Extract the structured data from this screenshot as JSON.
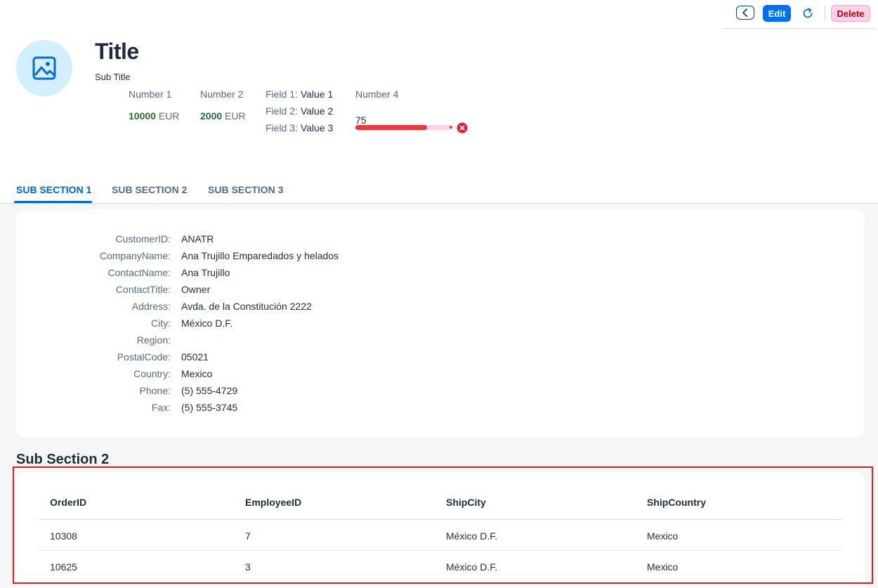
{
  "toolbar": {
    "edit_label": "Edit",
    "delete_label": "Delete"
  },
  "header": {
    "title": "Title",
    "subtitle": "Sub Title",
    "kpis": [
      {
        "label": "Number 1",
        "value": "10000",
        "unit": "EUR"
      },
      {
        "label": "Number 2",
        "value": "2000",
        "unit": "EUR"
      }
    ],
    "fields": [
      {
        "label": "Field 1:",
        "value": "Value 1"
      },
      {
        "label": "Field 2:",
        "value": "Value 2"
      },
      {
        "label": "Field 3:",
        "value": "Value 3"
      }
    ],
    "progress": {
      "label": "Number 4",
      "value_text": "75",
      "percent": 75,
      "color": "#ee3939"
    }
  },
  "tabs": [
    {
      "label": "SUB SECTION 1",
      "active": true
    },
    {
      "label": "SUB SECTION 2",
      "active": false
    },
    {
      "label": "SUB SECTION 3",
      "active": false
    }
  ],
  "form": {
    "rows": [
      {
        "label": "CustomerID:",
        "value": "ANATR"
      },
      {
        "label": "CompanyName:",
        "value": "Ana Trujillo Emparedados y helados"
      },
      {
        "label": "ContactName:",
        "value": "Ana Trujillo"
      },
      {
        "label": "ContactTitle:",
        "value": "Owner"
      },
      {
        "label": "Address:",
        "value": "Avda. de la Constitución 2222"
      },
      {
        "label": "City:",
        "value": "México D.F."
      },
      {
        "label": "Region:",
        "value": ""
      },
      {
        "label": "PostalCode:",
        "value": "05021"
      },
      {
        "label": "Country:",
        "value": "Mexico"
      },
      {
        "label": "Phone:",
        "value": "(5) 555-4729"
      },
      {
        "label": "Fax:",
        "value": "(5) 555-3745"
      }
    ]
  },
  "section2": {
    "title": "Sub Section 2",
    "columns": [
      "OrderID",
      "EmployeeID",
      "ShipCity",
      "ShipCountry"
    ],
    "rows": [
      [
        "10308",
        "7",
        "México D.F.",
        "Mexico"
      ],
      [
        "10625",
        "3",
        "México D.F.",
        "Mexico"
      ]
    ]
  },
  "icons": {
    "back": "chevron-left-icon",
    "refresh": "refresh-icon",
    "avatar": "image-placeholder-icon",
    "progress_status": "error-icon"
  },
  "colors": {
    "accent": "#0070f2",
    "positive": "#256f3a",
    "negative": "#ee3939",
    "highlight": "#e01d1d"
  }
}
